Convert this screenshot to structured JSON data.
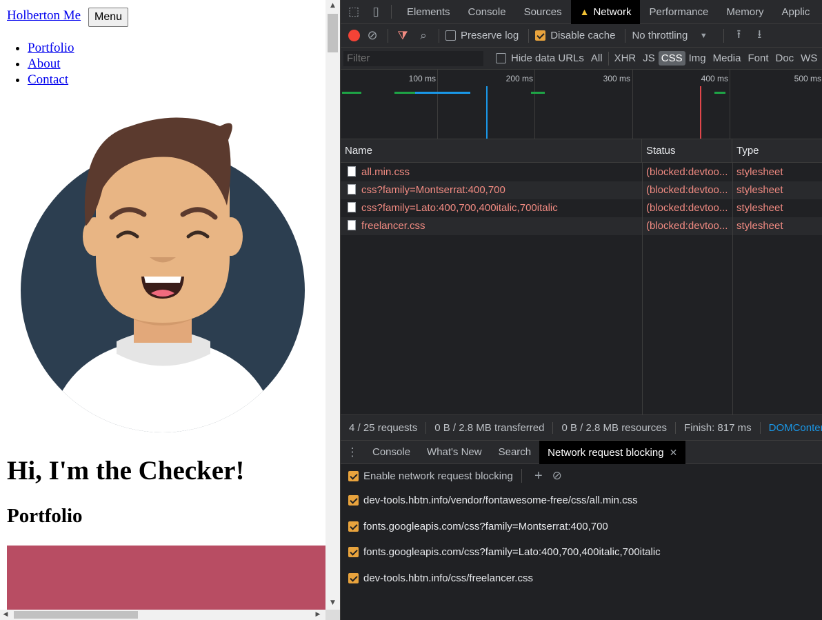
{
  "page": {
    "brand": "Holberton Me",
    "menu_button": "Menu",
    "nav": [
      "Portfolio",
      "About",
      "Contact"
    ],
    "heading": "Hi, I'm the Checker!",
    "subheading": "Portfolio",
    "colors": {
      "link": "#0000ee",
      "portfolio_block": "#b84d63",
      "avatar_bg": "#2c3e50"
    }
  },
  "devtools": {
    "tabs": [
      "Elements",
      "Console",
      "Sources",
      "Network",
      "Performance",
      "Memory",
      "Applic"
    ],
    "selected_tab": "Network",
    "toolbar": {
      "preserve_log": "Preserve log",
      "preserve_log_checked": false,
      "disable_cache": "Disable cache",
      "disable_cache_checked": true,
      "throttling": "No throttling"
    },
    "filter": {
      "placeholder": "Filter",
      "hide_data_urls": "Hide data URLs",
      "types": [
        "All",
        "XHR",
        "JS",
        "CSS",
        "Img",
        "Media",
        "Font",
        "Doc",
        "WS"
      ],
      "selected_type": "CSS"
    },
    "timeline": {
      "ticks": [
        "100 ms",
        "200 ms",
        "300 ms",
        "400 ms",
        "500 ms"
      ]
    },
    "table": {
      "columns": [
        "Name",
        "Status",
        "Type"
      ],
      "rows": [
        {
          "name": "all.min.css",
          "status": "(blocked:devtoo...",
          "type": "stylesheet"
        },
        {
          "name": "css?family=Montserrat:400,700",
          "status": "(blocked:devtoo...",
          "type": "stylesheet"
        },
        {
          "name": "css?family=Lato:400,700,400italic,700italic",
          "status": "(blocked:devtoo...",
          "type": "stylesheet"
        },
        {
          "name": "freelancer.css",
          "status": "(blocked:devtoo...",
          "type": "stylesheet"
        }
      ]
    },
    "summary": {
      "requests": "4 / 25 requests",
      "transferred": "0 B / 2.8 MB transferred",
      "resources": "0 B / 2.8 MB resources",
      "finish": "Finish: 817 ms",
      "dom": "DOMContentL"
    },
    "drawer": {
      "tabs": [
        "Console",
        "What's New",
        "Search",
        "Network request blocking"
      ],
      "selected": "Network request blocking",
      "enable_label": "Enable network request blocking",
      "patterns": [
        "dev-tools.hbtn.info/vendor/fontawesome-free/css/all.min.css",
        "fonts.googleapis.com/css?family=Montserrat:400,700",
        "fonts.googleapis.com/css?family=Lato:400,700,400italic,700italic",
        "dev-tools.hbtn.info/css/freelancer.css"
      ]
    },
    "colors": {
      "error_text": "#f28b82",
      "checkbox": "#e8a33d",
      "link": "#1a98e8",
      "record": "#f44336"
    }
  }
}
